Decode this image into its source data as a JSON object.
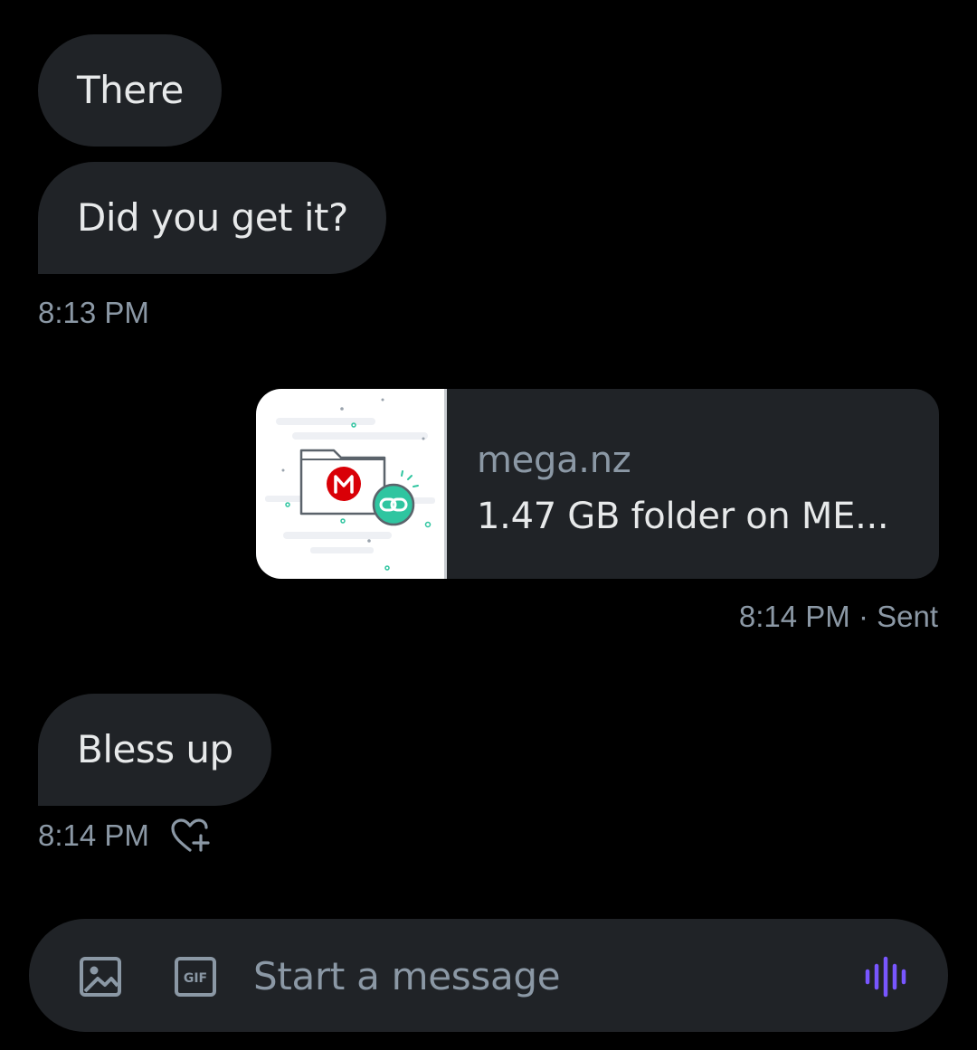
{
  "messages": [
    {
      "text": "There"
    },
    {
      "text": "Did you get it?"
    },
    {
      "time": "8:13 PM"
    }
  ],
  "link_card": {
    "domain": "mega.nz",
    "title": "1.47 GB folder on ME..."
  },
  "sent_meta": "8:14 PM · Sent",
  "last_message": {
    "text": "Bless up",
    "time": "8:14 PM"
  },
  "composer": {
    "placeholder": "Start a message",
    "gif_label": "GIF"
  },
  "colors": {
    "bubble": "#202327",
    "muted": "#8b98a5",
    "accent_voice": "#7856ff",
    "mega_red": "#d90007",
    "link_teal": "#2fc5a0"
  }
}
